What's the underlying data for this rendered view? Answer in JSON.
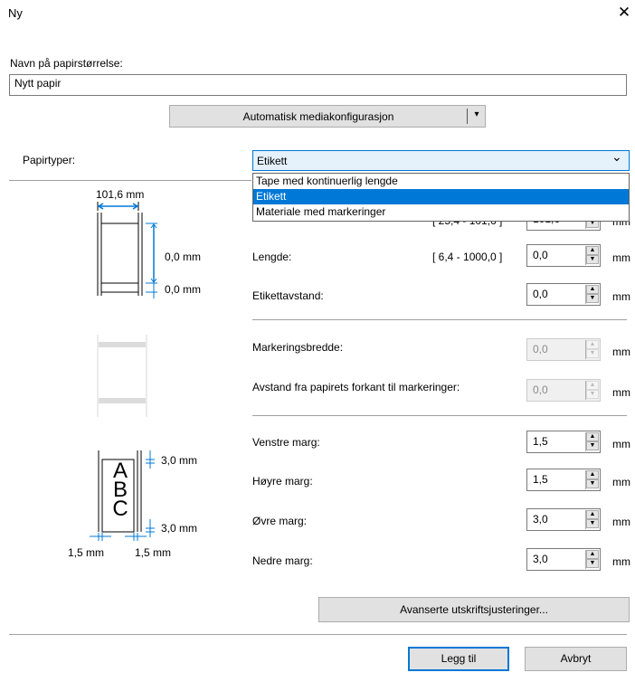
{
  "window": {
    "title": "Ny",
    "close_glyph": "✕"
  },
  "name_field": {
    "label": "Navn på papirstørrelse:",
    "value": "Nytt papir"
  },
  "auto_media_button": {
    "label": "Automatisk mediakonfigurasjon",
    "arrow": "▾"
  },
  "paper_types": {
    "label": "Papirtyper:",
    "selected": "Etikett",
    "options": [
      "Tape med kontinuerlig lengde",
      "Etikett",
      "Materiale med markeringer"
    ],
    "selected_index": 1,
    "chevron": "⌄"
  },
  "diagram1": {
    "width_label": "101,6 mm",
    "height_label": "0,0 mm",
    "gap_label": "0,0 mm"
  },
  "diagram3": {
    "letters": [
      "A",
      "B",
      "C"
    ],
    "top_margin_label": "3,0 mm",
    "bottom_margin_label": "3,0 mm",
    "left_margin_label": "1,5 mm",
    "right_margin_label": "1,5 mm"
  },
  "partial_hidden_row": {
    "range": "[ 25,4 - 101,6 ]",
    "value": "101,6",
    "unit": "mm"
  },
  "fields": {
    "length": {
      "label": "Lengde:",
      "range": "[ 6,4 - 1000,0 ]",
      "value": "0,0",
      "unit": "mm"
    },
    "label_gap": {
      "label": "Etikettavstand:",
      "value": "0,0",
      "unit": "mm"
    },
    "mark_width": {
      "label": "Markeringsbredde:",
      "value": "0,0",
      "unit": "mm"
    },
    "mark_distance": {
      "label": "Avstand fra papirets forkant til markeringer:",
      "value": "0,0",
      "unit": "mm"
    },
    "left_margin": {
      "label": "Venstre marg:",
      "value": "1,5",
      "unit": "mm"
    },
    "right_margin": {
      "label": "Høyre marg:",
      "value": "1,5",
      "unit": "mm"
    },
    "top_margin": {
      "label": "Øvre marg:",
      "value": "3,0",
      "unit": "mm"
    },
    "bottom_margin": {
      "label": "Nedre marg:",
      "value": "3,0",
      "unit": "mm"
    }
  },
  "advanced_button": {
    "label": "Avanserte utskriftsjusteringer..."
  },
  "add_button": {
    "label": "Legg til"
  },
  "cancel_button": {
    "label": "Avbryt"
  }
}
